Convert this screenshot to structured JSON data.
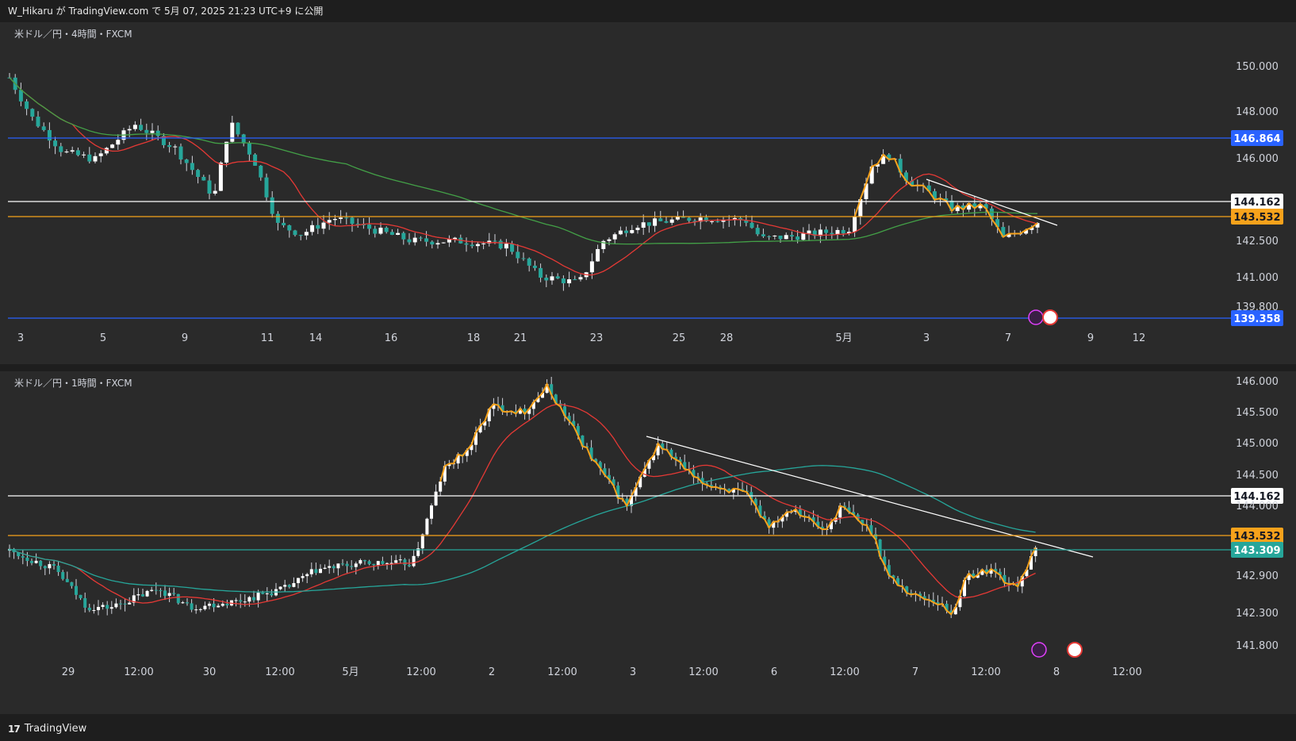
{
  "header": {
    "text": "W_Hikaru が TradingView.com で 5月 07, 2025 21:23 UTC+9 に公開"
  },
  "footer": {
    "logo": "17",
    "brand": "TradingView"
  },
  "colors": {
    "background": "#1e1e1e",
    "pane": "#2a2a2a",
    "up": "#ffffff",
    "down": "#26a69a",
    "wick": "#d1d4dc",
    "ma_red": "#e53935",
    "ma_green": "#43a047",
    "ma_teal": "#26a69a",
    "zigzag": "#f7a21b",
    "trend": "#ffffff",
    "blue": "#2962ff",
    "orange": "#f7a21b",
    "white": "#ffffff",
    "teal": "#26a69a"
  },
  "panes": [
    {
      "id": "4h",
      "title": "米ドル／円・4時間・FXCM",
      "y_ticks": [
        "150.000",
        "148.000",
        "146.000",
        "142.500",
        "141.000",
        "139.800"
      ],
      "x_ticks": [
        "3",
        "5",
        "9",
        "11",
        "14",
        "16",
        "18",
        "21",
        "23",
        "25",
        "28",
        "5月",
        "3",
        "7",
        "9",
        "12"
      ],
      "levels": [
        {
          "value": "146.864",
          "kind": "blue"
        },
        {
          "value": "144.162",
          "kind": "white"
        },
        {
          "value": "143.532",
          "kind": "orange"
        },
        {
          "value": "139.358",
          "kind": "blue"
        }
      ]
    },
    {
      "id": "1h",
      "title": "米ドル／円・1時間・FXCM",
      "y_ticks": [
        "146.000",
        "145.500",
        "145.000",
        "144.500",
        "144.000",
        "142.900",
        "142.300",
        "141.800"
      ],
      "x_ticks": [
        "29",
        "12:00",
        "30",
        "12:00",
        "5月",
        "12:00",
        "2",
        "12:00",
        "3",
        "12:00",
        "6",
        "12:00",
        "7",
        "12:00",
        "8",
        "12:00"
      ],
      "levels": [
        {
          "value": "144.162",
          "kind": "white"
        },
        {
          "value": "143.532",
          "kind": "orange"
        },
        {
          "value": "143.309",
          "kind": "teal"
        }
      ]
    }
  ]
}
